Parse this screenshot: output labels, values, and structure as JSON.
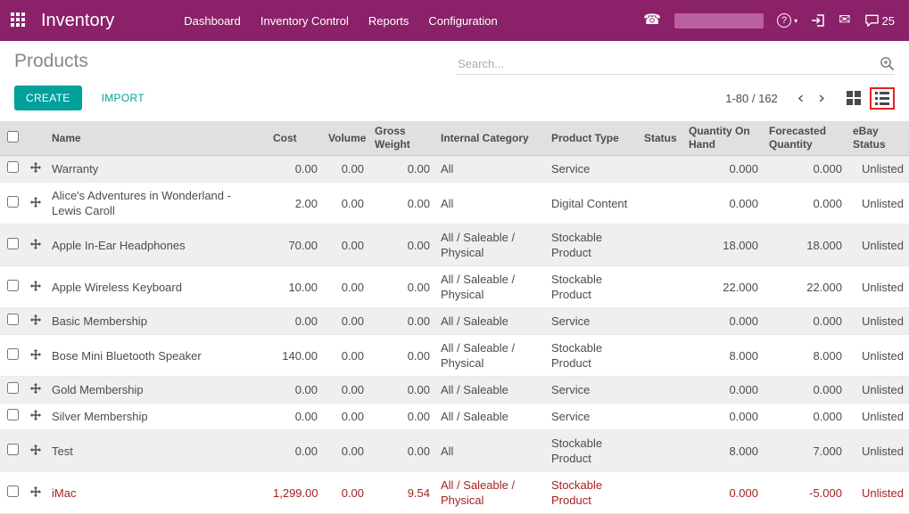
{
  "colors": {
    "topbar": "#8b2168",
    "redacted": "#b9619f",
    "accent": "#00a09b",
    "danger": "#a3231f",
    "annotation": "#e8211d"
  },
  "topbar": {
    "app_title": "Inventory",
    "menu": [
      "Dashboard",
      "Inventory Control",
      "Reports",
      "Configuration"
    ],
    "messages_count": "25",
    "icons": [
      "apps-grid",
      "phone",
      "help-question",
      "sign-in",
      "envelope",
      "chat-bubble"
    ]
  },
  "control_panel": {
    "title": "Products",
    "search_placeholder": "Search...",
    "create_label": "CREATE",
    "import_label": "IMPORT",
    "pager": {
      "range": "1-80 / 162",
      "prev": "‹",
      "next": "›"
    }
  },
  "table": {
    "headers": {
      "name": "Name",
      "cost": "Cost",
      "volume": "Volume",
      "gross_weight": "Gross Weight",
      "category": "Internal Category",
      "type": "Product Type",
      "status": "Status",
      "qty_on_hand": "Quantity On Hand",
      "forecasted": "Forecasted Quantity",
      "ebay": "eBay Status"
    },
    "rows": [
      {
        "name": "Warranty",
        "cost": "0.00",
        "volume": "0.00",
        "gross_weight": "0.00",
        "category": "All",
        "type": "Service",
        "status": "",
        "qty_on_hand": "0.000",
        "forecasted": "0.000",
        "ebay": "Unlisted",
        "danger": false
      },
      {
        "name": "Alice's Adventures in Wonderland - Lewis Caroll",
        "cost": "2.00",
        "volume": "0.00",
        "gross_weight": "0.00",
        "category": "All",
        "type": "Digital Content",
        "status": "",
        "qty_on_hand": "0.000",
        "forecasted": "0.000",
        "ebay": "Unlisted",
        "danger": false
      },
      {
        "name": "Apple In-Ear Headphones",
        "cost": "70.00",
        "volume": "0.00",
        "gross_weight": "0.00",
        "category": "All / Saleable / Physical",
        "type": "Stockable Product",
        "status": "",
        "qty_on_hand": "18.000",
        "forecasted": "18.000",
        "ebay": "Unlisted",
        "danger": false
      },
      {
        "name": "Apple Wireless Keyboard",
        "cost": "10.00",
        "volume": "0.00",
        "gross_weight": "0.00",
        "category": "All / Saleable / Physical",
        "type": "Stockable Product",
        "status": "",
        "qty_on_hand": "22.000",
        "forecasted": "22.000",
        "ebay": "Unlisted",
        "danger": false
      },
      {
        "name": "Basic Membership",
        "cost": "0.00",
        "volume": "0.00",
        "gross_weight": "0.00",
        "category": "All / Saleable",
        "type": "Service",
        "status": "",
        "qty_on_hand": "0.000",
        "forecasted": "0.000",
        "ebay": "Unlisted",
        "danger": false
      },
      {
        "name": "Bose Mini Bluetooth Speaker",
        "cost": "140.00",
        "volume": "0.00",
        "gross_weight": "0.00",
        "category": "All / Saleable / Physical",
        "type": "Stockable Product",
        "status": "",
        "qty_on_hand": "8.000",
        "forecasted": "8.000",
        "ebay": "Unlisted",
        "danger": false
      },
      {
        "name": "Gold Membership",
        "cost": "0.00",
        "volume": "0.00",
        "gross_weight": "0.00",
        "category": "All / Saleable",
        "type": "Service",
        "status": "",
        "qty_on_hand": "0.000",
        "forecasted": "0.000",
        "ebay": "Unlisted",
        "danger": false
      },
      {
        "name": "Silver Membership",
        "cost": "0.00",
        "volume": "0.00",
        "gross_weight": "0.00",
        "category": "All / Saleable",
        "type": "Service",
        "status": "",
        "qty_on_hand": "0.000",
        "forecasted": "0.000",
        "ebay": "Unlisted",
        "danger": false
      },
      {
        "name": "Test",
        "cost": "0.00",
        "volume": "0.00",
        "gross_weight": "0.00",
        "category": "All",
        "type": "Stockable Product",
        "status": "",
        "qty_on_hand": "8.000",
        "forecasted": "7.000",
        "ebay": "Unlisted",
        "danger": false
      },
      {
        "name": "iMac",
        "cost": "1,299.00",
        "volume": "0.00",
        "gross_weight": "9.54",
        "category": "All / Saleable / Physical",
        "type": "Stockable Product",
        "status": "",
        "qty_on_hand": "0.000",
        "forecasted": "-5.000",
        "ebay": "Unlisted",
        "danger": true
      }
    ]
  }
}
